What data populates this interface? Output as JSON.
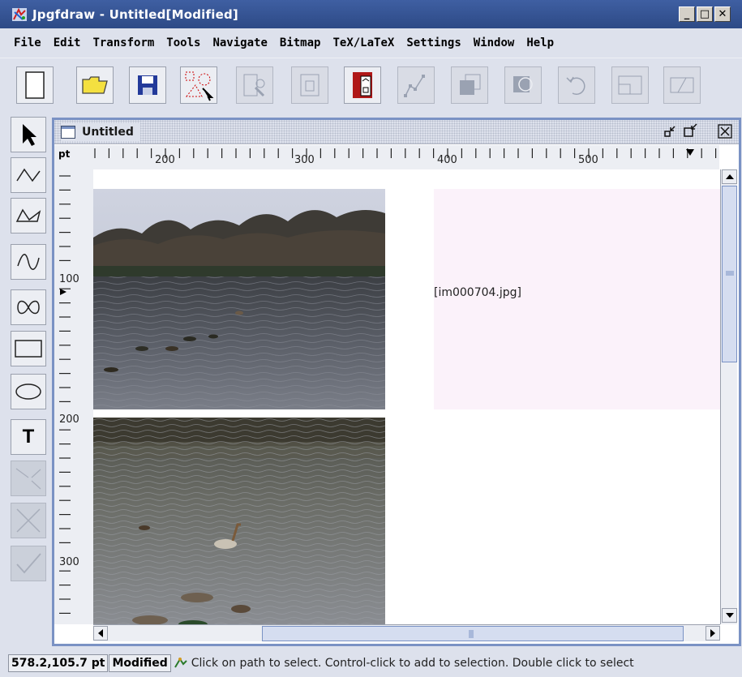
{
  "window": {
    "title": "Jpgfdraw - Untitled[Modified]",
    "controls": {
      "minimize": "_",
      "maximize": "□",
      "close": "✕"
    }
  },
  "menubar": {
    "items": [
      "File",
      "Edit",
      "Transform",
      "Tools",
      "Navigate",
      "Bitmap",
      "TeX/LaTeX",
      "Settings",
      "Window",
      "Help"
    ]
  },
  "toolbar": {
    "buttons": [
      {
        "name": "new",
        "icon": "new-document-icon",
        "enabled": true
      },
      {
        "name": "open",
        "icon": "open-folder-icon",
        "enabled": true
      },
      {
        "name": "save",
        "icon": "save-disk-icon",
        "enabled": true
      },
      {
        "name": "select-all",
        "icon": "select-all-icon",
        "enabled": true
      },
      {
        "name": "group",
        "icon": "group-icon",
        "enabled": false
      },
      {
        "name": "ungroup",
        "icon": "ungroup-icon",
        "enabled": false
      },
      {
        "name": "image",
        "icon": "image-properties-icon",
        "enabled": true
      },
      {
        "name": "edit-path",
        "icon": "edit-path-icon",
        "enabled": false
      },
      {
        "name": "move-to-front",
        "icon": "move-front-icon",
        "enabled": false
      },
      {
        "name": "move-to-back",
        "icon": "move-back-icon",
        "enabled": false
      },
      {
        "name": "rotate",
        "icon": "rotate-icon",
        "enabled": false
      },
      {
        "name": "scale",
        "icon": "scale-icon",
        "enabled": false
      },
      {
        "name": "shear",
        "icon": "shear-icon",
        "enabled": false
      }
    ]
  },
  "palette": {
    "tools": [
      {
        "name": "select",
        "icon": "arrow-pointer-icon",
        "enabled": true
      },
      {
        "name": "open-line",
        "icon": "open-line-icon",
        "enabled": true
      },
      {
        "name": "closed-line",
        "icon": "closed-line-icon",
        "enabled": true
      },
      {
        "name": "open-curve",
        "icon": "open-curve-icon",
        "enabled": true
      },
      {
        "name": "closed-curve",
        "icon": "closed-curve-icon",
        "enabled": true
      },
      {
        "name": "rectangle",
        "icon": "rectangle-icon",
        "enabled": true
      },
      {
        "name": "ellipse",
        "icon": "ellipse-icon",
        "enabled": true
      },
      {
        "name": "text",
        "icon": "text-icon",
        "label": "T",
        "enabled": true
      },
      {
        "name": "gap",
        "icon": "gap-icon",
        "enabled": false
      },
      {
        "name": "abandon",
        "icon": "abandon-x-icon",
        "enabled": false
      },
      {
        "name": "finish",
        "icon": "finish-check-icon",
        "enabled": false
      }
    ]
  },
  "document": {
    "title": "Untitled",
    "ruler_unit": "pt",
    "top_ruler_labels": [
      "200",
      "300",
      "400",
      "500"
    ],
    "left_ruler_labels": [
      "100",
      "200",
      "300"
    ],
    "placeholder_label": "[im000704.jpg]"
  },
  "status": {
    "coordinates": "578.2,105.7 pt",
    "modified": "Modified",
    "message": "Click on path to select. Control-click to add to selection. Double click to select"
  },
  "colors": {
    "titlebar": "#2d4a86",
    "chrome": "#dde1ec",
    "frame_border": "#7a92c4",
    "placeholder_bg": "#fbf2fa"
  }
}
